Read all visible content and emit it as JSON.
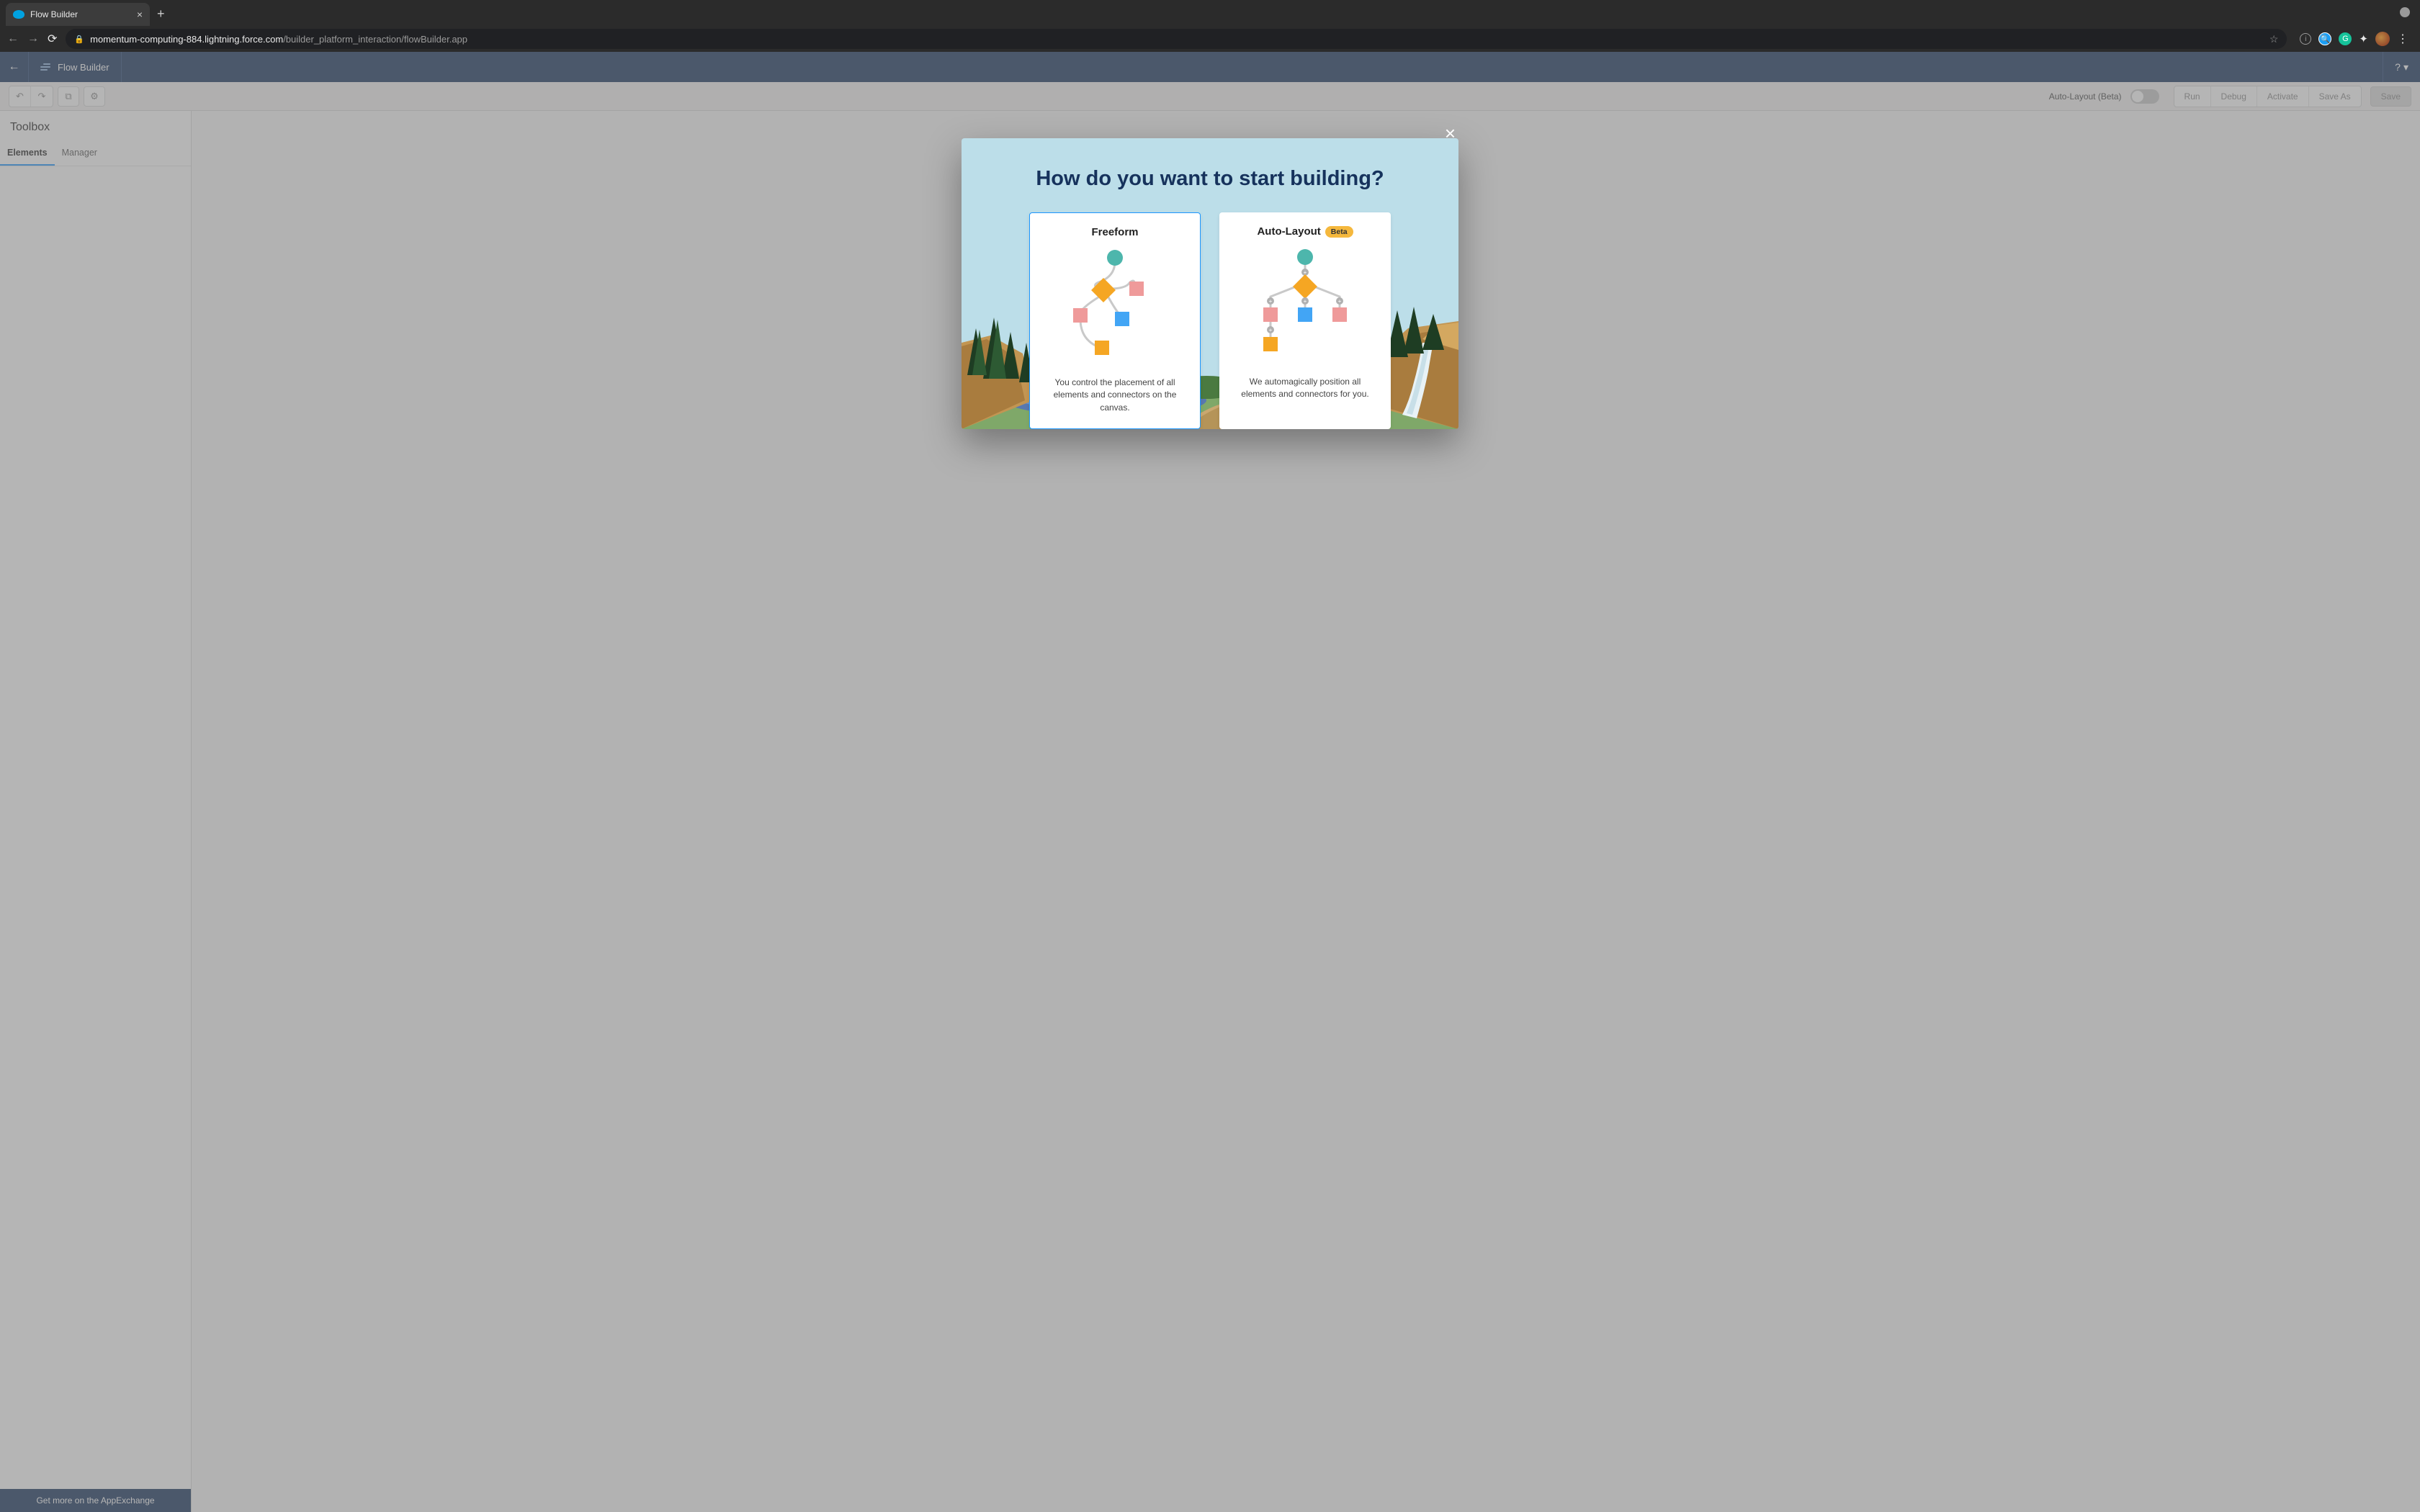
{
  "browser": {
    "tab_title": "Flow Builder",
    "url_domain": "momentum-computing-884.lightning.force.com",
    "url_path": "/builder_platform_interaction/flowBuilder.app"
  },
  "header": {
    "brand": "Flow Builder",
    "help_label": "?"
  },
  "toolbar": {
    "auto_layout_label": "Auto-Layout (Beta)",
    "buttons": {
      "run": "Run",
      "debug": "Debug",
      "activate": "Activate",
      "save_as": "Save As",
      "save": "Save"
    }
  },
  "sidebar": {
    "title": "Toolbox",
    "tabs": {
      "elements": "Elements",
      "manager": "Manager"
    },
    "footer": "Get more on the AppExchange"
  },
  "modal": {
    "title": "How do you want to start building?",
    "cards": [
      {
        "title": "Freeform",
        "beta": false,
        "desc": "You control the placement of all elements and connectors on the canvas."
      },
      {
        "title": "Auto-Layout",
        "beta": true,
        "beta_label": "Beta",
        "desc": "We automagically position all elements and connectors for you."
      }
    ]
  }
}
